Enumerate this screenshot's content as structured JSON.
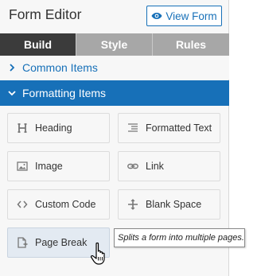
{
  "header": {
    "title": "Form Editor",
    "view_form_label": "View Form",
    "view_form_icon": "eye-icon"
  },
  "tabs": [
    {
      "label": "Build",
      "active": true
    },
    {
      "label": "Style",
      "active": false
    },
    {
      "label": "Rules",
      "active": false
    }
  ],
  "sections": {
    "common": {
      "label": "Common Items",
      "expanded": false
    },
    "formatting": {
      "label": "Formatting Items",
      "expanded": true
    }
  },
  "items": [
    {
      "label": "Heading",
      "icon": "heading-icon"
    },
    {
      "label": "Formatted Text",
      "icon": "formatted-text-icon"
    },
    {
      "label": "Image",
      "icon": "image-icon"
    },
    {
      "label": "Link",
      "icon": "link-icon"
    },
    {
      "label": "Custom Code",
      "icon": "code-icon"
    },
    {
      "label": "Blank Space",
      "icon": "blank-space-icon"
    },
    {
      "label": "Page Break",
      "icon": "page-break-icon"
    }
  ],
  "tooltip": "Splits a form into multiple pages.",
  "colors": {
    "accent": "#1770b8",
    "active_tab": "#3b3b3b",
    "inactive_tab": "#a7a7a7",
    "hover_item": "#e3eaf2"
  }
}
